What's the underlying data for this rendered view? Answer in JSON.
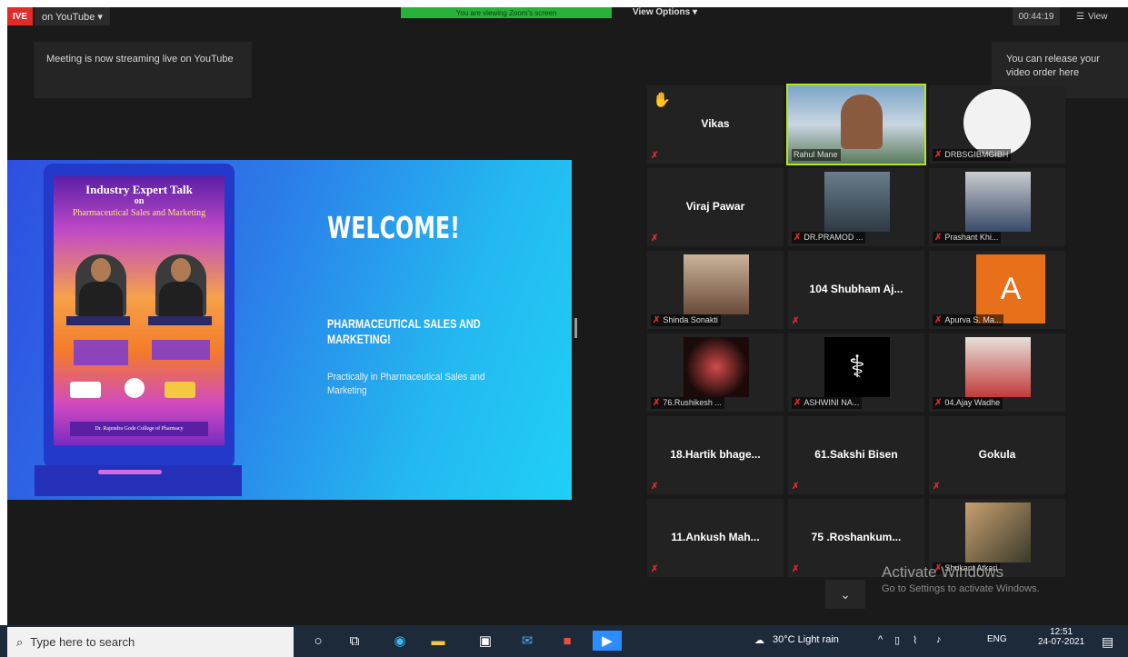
{
  "topbar": {
    "live": "IVE",
    "youtube": "on YouTube ▾",
    "green_bar": "You are viewing Zoom's screen",
    "view_options": "View Options ▾",
    "timer": "00:44:19",
    "view_btn": "View"
  },
  "tooltips": {
    "streaming": "Meeting is now streaming live on YouTube",
    "release": "You can release your video order here"
  },
  "slide": {
    "poster_title": "Industry Expert Talk",
    "poster_on": "on",
    "poster_subtitle": "Pharmaceutical Sales and Marketing",
    "college": "Dr. Rajendra Gode College of Pharmacy",
    "welcome": "WELCOME!",
    "title": "PHARMACEUTICAL SALES AND MARKETING!",
    "desc": "Practically in Pharmaceutical Sales and Marketing"
  },
  "participants": [
    {
      "name": "Vikas",
      "label": "",
      "kind": "name",
      "hand": true
    },
    {
      "name": "",
      "label": "Rahul Mane",
      "kind": "video",
      "active": true
    },
    {
      "name": "",
      "label": "DRBSGIBMGIBH",
      "kind": "logo"
    },
    {
      "name": "Viraj Pawar",
      "label": "",
      "kind": "name"
    },
    {
      "name": "",
      "label": "DR.PRAMOD ...",
      "kind": "photo"
    },
    {
      "name": "",
      "label": "Prashant Khi...",
      "kind": "photo"
    },
    {
      "name": "",
      "label": "Shinda Sonakti",
      "kind": "photo"
    },
    {
      "name": "104 Shubham Aj...",
      "label": "",
      "kind": "name"
    },
    {
      "name": "",
      "label": "Apurva S. Ma...",
      "kind": "avatar",
      "letter": "A"
    },
    {
      "name": "",
      "label": "76.Rushikesh ...",
      "kind": "photo"
    },
    {
      "name": "",
      "label": "ASHWINI NA...",
      "kind": "photo"
    },
    {
      "name": "",
      "label": "04.Ajay Wadhe",
      "kind": "photo"
    },
    {
      "name": "18.Hartik  bhage...",
      "label": "",
      "kind": "name"
    },
    {
      "name": "61.Sakshi Bisen",
      "label": "",
      "kind": "name"
    },
    {
      "name": "Gokula",
      "label": "",
      "kind": "name"
    },
    {
      "name": "11.Ankush  Mah...",
      "label": "",
      "kind": "name"
    },
    {
      "name": "75  .Roshankum...",
      "label": "",
      "kind": "name"
    },
    {
      "name": "",
      "label": "Shrikant Atkari",
      "kind": "photo"
    }
  ],
  "watermark": {
    "line1": "Activate Windows",
    "line2": "Go to Settings to activate Windows."
  },
  "taskbar": {
    "search_placeholder": "Type here to search",
    "weather": "30°C  Light rain",
    "lang": "ENG",
    "time": "12:51",
    "date": "24-07-2021"
  }
}
